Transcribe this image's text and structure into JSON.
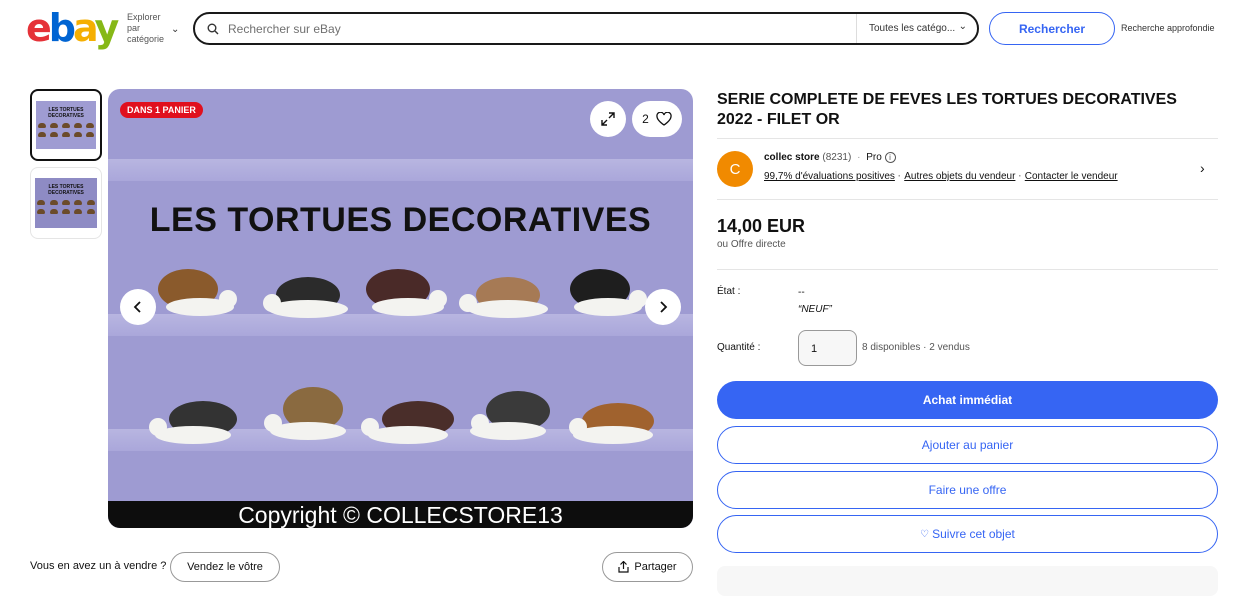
{
  "header": {
    "logo_text": "ebay",
    "explore_label": "Explorer par catégorie",
    "search_placeholder": "Rechercher sur eBay",
    "category_select": "Toutes les catégo...",
    "search_button": "Rechercher",
    "advanced_link": "Recherche approfondie"
  },
  "gallery": {
    "badge": "DANS 1 PANIER",
    "watch_count": "2",
    "image_title": "LES TORTUES DECORATIVES",
    "image_copyright": "Copyright © COLLECSTORE13",
    "thumb1_caption": "LES TORTUES DECORATIVES",
    "thumb2_caption": "LES TORTUES DECORATIVES"
  },
  "actions_below": {
    "sell_question": "Vous en avez un à vendre ?",
    "sell_button": "Vendez le vôtre",
    "share_button": "Partager"
  },
  "product": {
    "title": "SERIE COMPLETE DE FEVES LES TORTUES DECORATIVES 2022 - FILET OR",
    "seller_initial": "C",
    "seller_name": "collec store",
    "seller_count": "(8231)",
    "seller_type": "Pro",
    "feedback_link": "99,7% d'évaluations positives",
    "other_items_link": "Autres objets du vendeur",
    "contact_link": "Contacter le vendeur",
    "price": "14,00 EUR",
    "offer_note": "ou Offre directe",
    "condition_label": "État :",
    "condition_value": "--",
    "condition_note": "“NEUF”",
    "quantity_label": "Quantité :",
    "quantity_value": "1",
    "availability": "8 disponibles · 2 vendus",
    "buy_now": "Achat immédiat",
    "add_to_cart": "Ajouter au panier",
    "make_offer": "Faire une offre",
    "watch_item": "Suivre cet objet"
  }
}
